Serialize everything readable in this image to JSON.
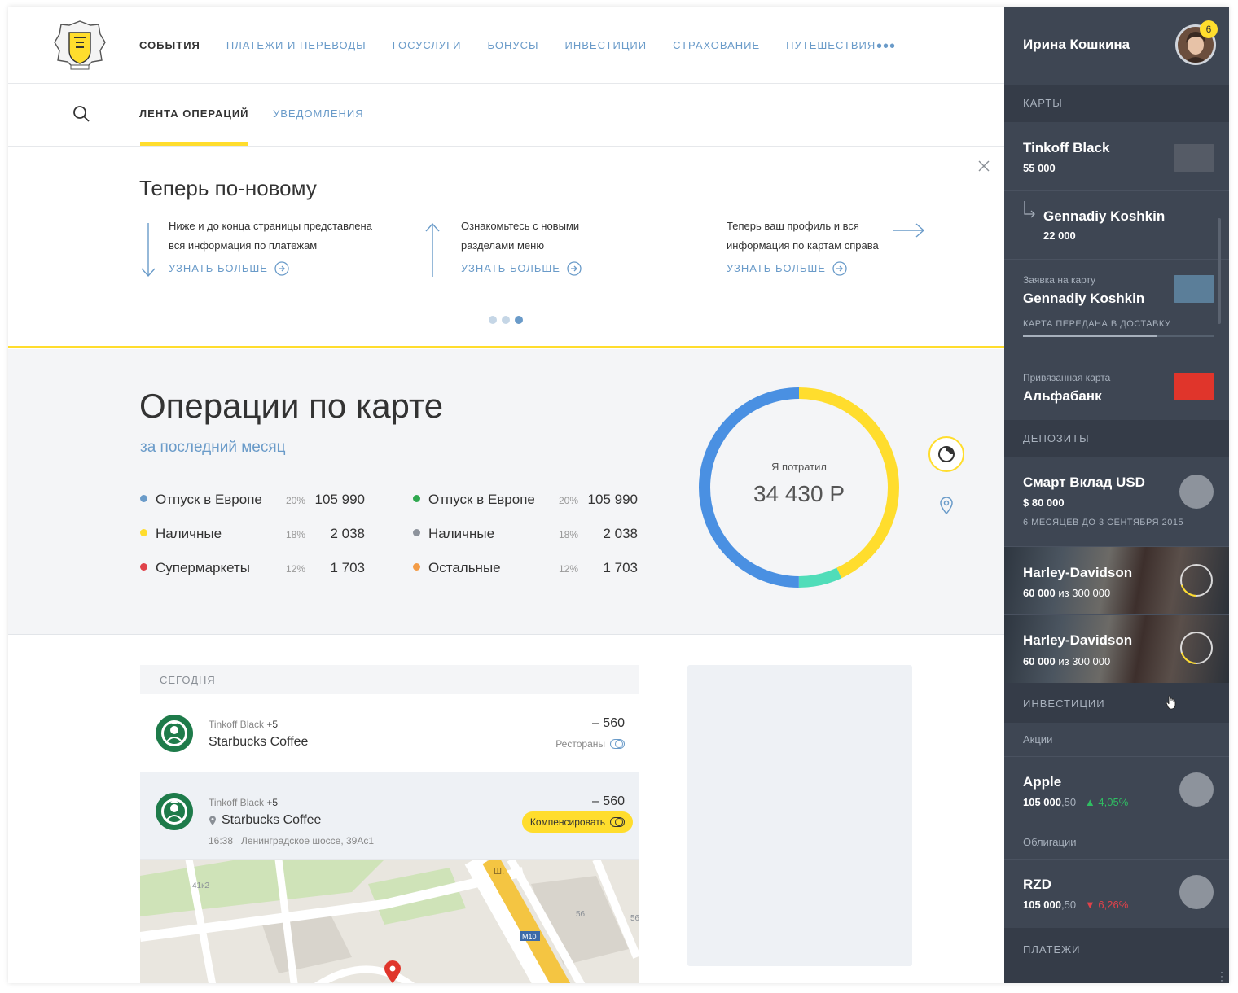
{
  "nav": {
    "items": [
      "СОБЫТИЯ",
      "ПЛАТЕЖИ И ПЕРЕВОДЫ",
      "ГОСУСЛУГИ",
      "БОНУСЫ",
      "ИНВЕСТИЦИИ",
      "СТРАХОВАНИЕ",
      "ПУТЕШЕСТВИЯ"
    ],
    "more": "•••"
  },
  "subnav": {
    "tab1": "ЛЕНТА ОПЕРАЦИЙ",
    "tab2": "УВЕДОМЛЕНИЯ"
  },
  "promo": {
    "title": "Теперь по-новому",
    "tip1": {
      "line1": "Ниже и до конца страницы представлена",
      "line2": "вся информация по платежам",
      "more": "УЗНАТЬ БОЛЬШЕ"
    },
    "tip2": {
      "line1": "Ознакомьтесь  с новыми",
      "line2": "разделами меню",
      "more": "УЗНАТЬ БОЛЬШЕ"
    },
    "tip3": {
      "line1": "Теперь ваш профиль и вся",
      "line2": "информация по картам справа",
      "more": "УЗНАТЬ БОЛЬШЕ"
    },
    "active_slide": 3,
    "slides": 3
  },
  "operations": {
    "title": "Операции по карте",
    "subtitle": "за последний месяц",
    "spent_label": "Я потратил",
    "spent_value": "34 430 Р",
    "categories": [
      {
        "name": "Отпуск в Европе",
        "pct": "20%",
        "amount": "105 990",
        "color": "#6a9bc9"
      },
      {
        "name": "Наличные",
        "pct": "18%",
        "amount": "2 038",
        "color": "#ffdd2d"
      },
      {
        "name": "Супермаркеты",
        "pct": "12%",
        "amount": "1 703",
        "color": "#e0424a"
      },
      {
        "name": "Отпуск в Европе",
        "pct": "20%",
        "amount": "105 990",
        "color": "#2fa84f"
      },
      {
        "name": "Наличные",
        "pct": "18%",
        "amount": "2 038",
        "color": "#8d939c"
      },
      {
        "name": "Остальные",
        "pct": "12%",
        "amount": "1 703",
        "color": "#f39c47"
      }
    ],
    "donut": {
      "segments": [
        {
          "label": "yellow",
          "fraction": 0.43,
          "color": "#ffdd2d"
        },
        {
          "label": "teal",
          "fraction": 0.07,
          "color": "#50ddb9"
        },
        {
          "label": "blue",
          "fraction": 0.5,
          "color": "#4a90e2"
        }
      ]
    }
  },
  "feed": {
    "section": "СЕГОДНЯ",
    "tx1": {
      "card": "Tinkoff Black",
      "plus": "+5",
      "merchant": "Starbucks Coffee",
      "amount": "– 560",
      "category": "Рестораны"
    },
    "tx2": {
      "card": "Tinkoff Black",
      "plus": "+5",
      "merchant": "Starbucks Coffee",
      "amount": "– 560",
      "compensate": "Компенсировать",
      "time": "16:38",
      "address": "Ленинградское шоссе, 39Ас1"
    },
    "map": {
      "labels": [
        "41к2",
        "Ш.",
        "56",
        "56",
        "M10"
      ]
    }
  },
  "sidebar": {
    "user": "Ирина Кошкина",
    "badge": "6",
    "cards_title": "КАРТЫ",
    "cards": {
      "c1": {
        "name": "Tinkoff Black",
        "amount": "55 000",
        "color": "#555b66"
      },
      "c2": {
        "name": "Gennadiy Koshkin",
        "amount": "22 000"
      },
      "c3": {
        "label": "Заявка на карту",
        "name": "Gennadiy Koshkin",
        "status": "КАРТА ПЕРЕДАНА В ДОСТАВКУ",
        "color": "#5b7e99",
        "progress": 0.7
      },
      "c4": {
        "label": "Привязанная карта",
        "name": "Альфабанк",
        "color": "#e0352b"
      }
    },
    "deposits_title": "ДЕПОЗИТЫ",
    "deposits": {
      "d1": {
        "name": "Смарт Вклад USD",
        "amount": "$ 80 000",
        "note": "6 МЕСЯЦЕВ ДО 3 СЕНТЯБРЯ 2015"
      },
      "d2": {
        "name": "Harley-Davidson",
        "amount": "60 000",
        "of": "из",
        "target": "300 000",
        "progress": 0.2
      },
      "d3": {
        "name": "Harley-Davidson",
        "amount": "60 000",
        "of": "из",
        "target": "300 000",
        "progress": 0.2
      }
    },
    "invest_title": "ИНВЕСТИЦИИ",
    "stocks_label": "Акции",
    "apple": {
      "name": "Apple",
      "value": "105 000",
      "cents": ",50",
      "change": "4,05%"
    },
    "bonds_label": "Облигации",
    "rzd": {
      "name": "RZD",
      "value": "105 000",
      "cents": ",50",
      "change": "6,26%"
    },
    "payments_title": "ПЛАТЕЖИ"
  }
}
